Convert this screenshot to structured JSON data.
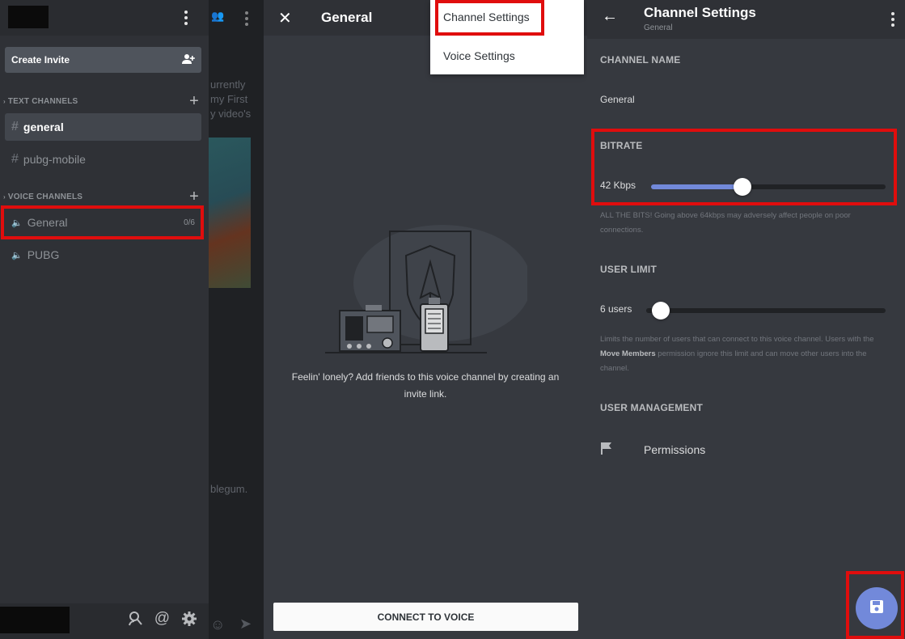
{
  "sidebar": {
    "create_invite_label": "Create Invite",
    "text_channels_header": "TEXT CHANNELS",
    "voice_channels_header": "VOICE CHANNELS",
    "text_channels": [
      "general",
      "pubg-mobile"
    ],
    "voice_channels": [
      {
        "name": "General",
        "count": "0/6"
      },
      {
        "name": "PUBG",
        "count": ""
      }
    ]
  },
  "behind_chat": {
    "lines": [
      "urrently",
      "my First",
      "y video's",
      "blegum."
    ]
  },
  "voice_panel": {
    "title": "General",
    "menu_items": [
      "Channel Settings",
      "Voice Settings"
    ],
    "empty_text": "Feelin' lonely? Add friends to this voice channel by creating an invite link.",
    "connect_label": "CONNECT TO VOICE"
  },
  "settings": {
    "title": "Channel Settings",
    "subtitle": "General",
    "channel_name_label": "CHANNEL NAME",
    "channel_name_value": "General",
    "bitrate_label": "BITRATE",
    "bitrate_value": "42 Kbps",
    "bitrate_fraction": 0.39,
    "bitrate_hint": "ALL THE BITS! Going above 64kbps may adversely affect people on poor connections.",
    "user_limit_label": "USER LIMIT",
    "user_limit_value": "6 users",
    "user_limit_fraction": 0.06,
    "user_limit_hint_pre": "Limits the number of users that can connect to this voice channel. Users with the ",
    "user_limit_hint_bold": "Move Members",
    "user_limit_hint_post": " permission ignore this limit and can move other users into the channel.",
    "user_management_label": "USER MANAGEMENT",
    "permissions_label": "Permissions"
  },
  "icons": [
    "kebab-icon",
    "add-person-icon",
    "plus-icon",
    "hash-icon",
    "speaker-icon",
    "search-icon",
    "mention-icon",
    "gear-icon",
    "close-icon",
    "back-arrow-icon",
    "flag-icon",
    "save-icon",
    "emoji-icon",
    "send-icon"
  ],
  "colors": {
    "highlight": "#e00d0d",
    "accent": "#7289da"
  }
}
